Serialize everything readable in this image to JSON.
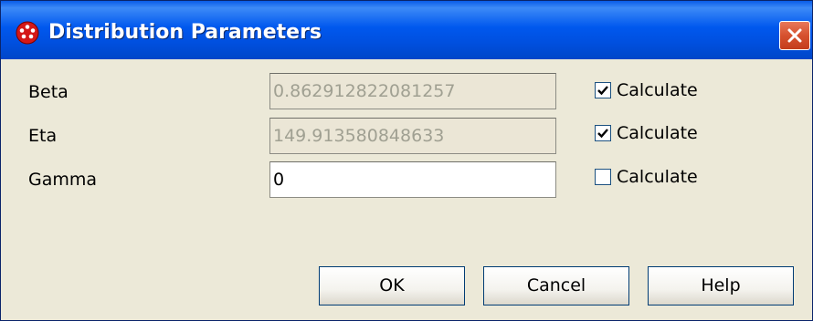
{
  "window": {
    "title": "Distribution Parameters"
  },
  "fields": [
    {
      "label": "Beta",
      "value": "0.862912822081257",
      "calculate_label": "Calculate",
      "calculate_checked": true,
      "enabled": false
    },
    {
      "label": "Eta",
      "value": "149.913580848633",
      "calculate_label": "Calculate",
      "calculate_checked": true,
      "enabled": false
    },
    {
      "label": "Gamma",
      "value": "0",
      "calculate_label": "Calculate",
      "calculate_checked": false,
      "enabled": true
    }
  ],
  "buttons": {
    "ok": "OK",
    "cancel": "Cancel",
    "help": "Help"
  },
  "colors": {
    "titlebar": "#0058ee",
    "dialog_bg": "#ece9d8",
    "disabled_field_bg": "#ebe6d6",
    "close_button": "#d6512e"
  }
}
